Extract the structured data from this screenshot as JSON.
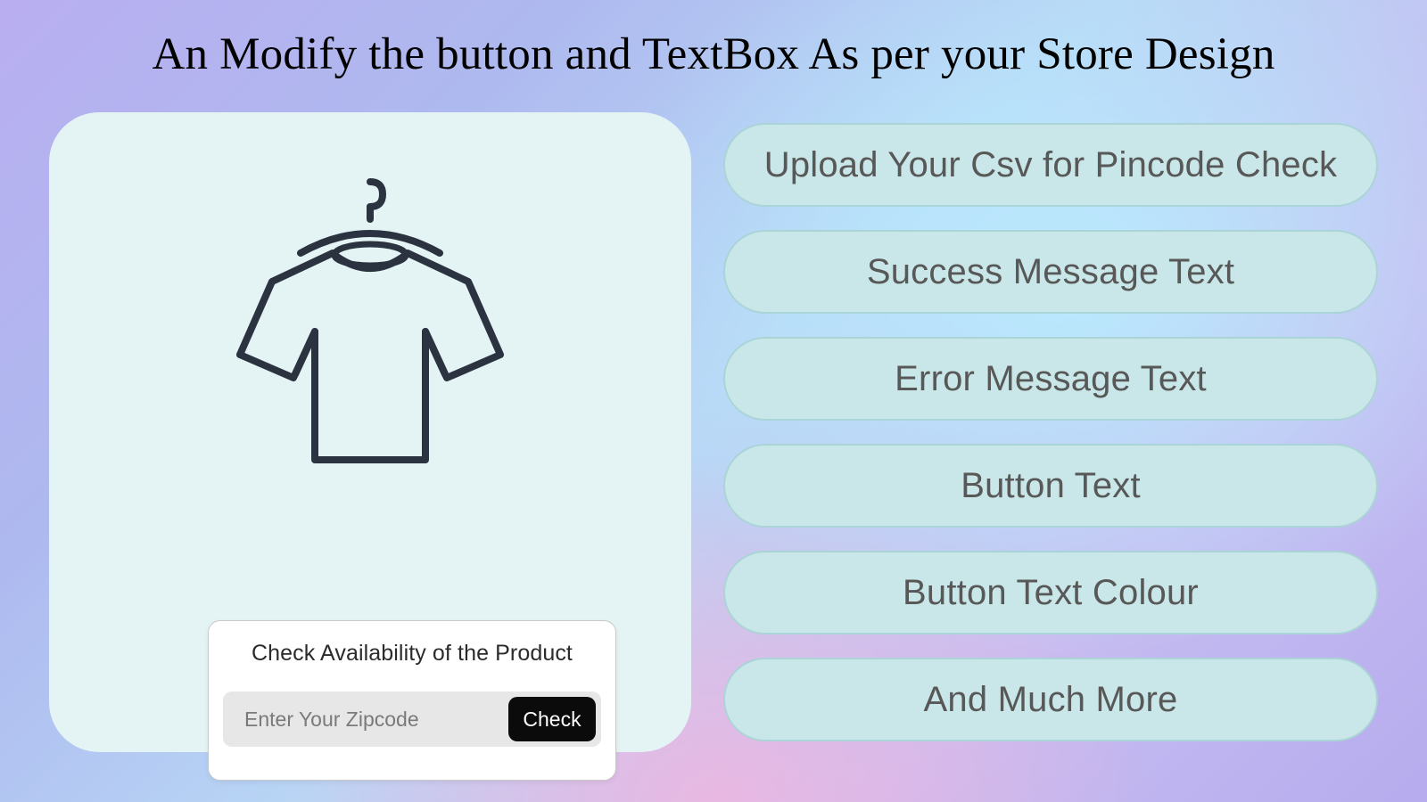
{
  "heading": "An Modify the button and TextBox As per your Store Design",
  "product_card": {
    "check_title": "Check Availability of the Product",
    "zip_placeholder": "Enter Your Zipcode",
    "check_button_label": "Check"
  },
  "features": [
    "Upload Your Csv for Pincode Check",
    "Success Message Text",
    "Error Message Text",
    "Button Text",
    "Button Text Colour",
    "And Much More"
  ]
}
